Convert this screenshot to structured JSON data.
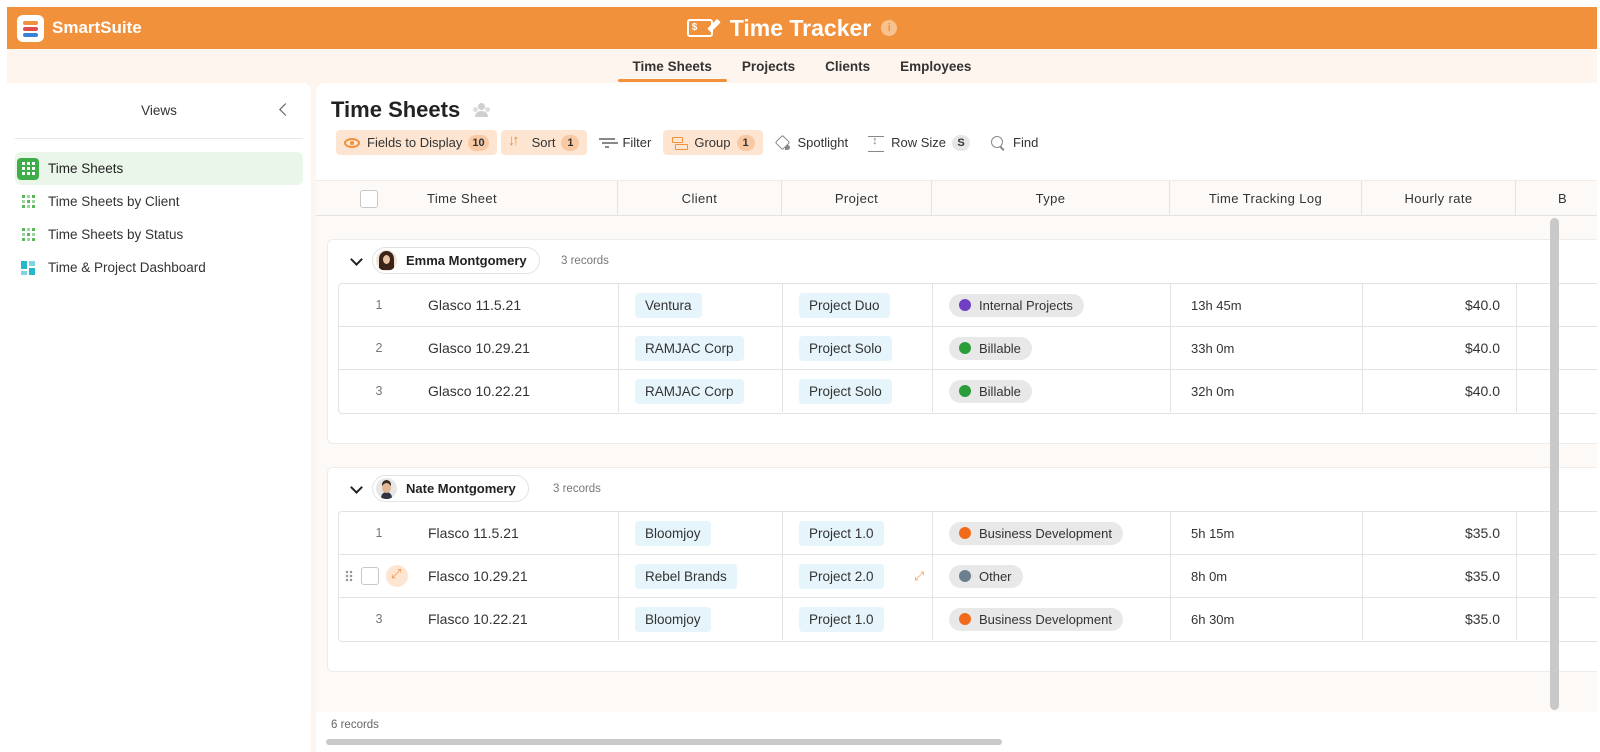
{
  "brand": {
    "name": "SmartSuite"
  },
  "app": {
    "title": "Time Tracker",
    "info": "i"
  },
  "nav": {
    "tabs": [
      "Time Sheets",
      "Projects",
      "Clients",
      "Employees"
    ]
  },
  "sidebar": {
    "title": "Views",
    "items": [
      {
        "label": "Time Sheets"
      },
      {
        "label": "Time Sheets by Client"
      },
      {
        "label": "Time Sheets by Status"
      },
      {
        "label": "Time & Project Dashboard"
      }
    ]
  },
  "main": {
    "title": "Time Sheets",
    "toolbar": {
      "fields_label": "Fields to Display",
      "fields_count": "10",
      "sort_label": "Sort",
      "sort_count": "1",
      "filter_label": "Filter",
      "group_label": "Group",
      "group_count": "1",
      "spotlight_label": "Spotlight",
      "rowsize_label": "Row Size",
      "rowsize_value": "S",
      "find_label": "Find"
    },
    "columns": [
      "Time Sheet",
      "Client",
      "Project",
      "Type",
      "Time Tracking Log",
      "Hourly rate",
      "B"
    ],
    "groups": [
      {
        "assignee": "Emma Montgomery",
        "count": "3 records",
        "rows": [
          {
            "idx": "1",
            "name": "Glasco 11.5.21",
            "client": "Ventura",
            "project": "Project Duo",
            "type": "Internal Projects",
            "type_color": "#6f3fc4",
            "log": "13h 45m",
            "rate": "$40.0"
          },
          {
            "idx": "2",
            "name": "Glasco 10.29.21",
            "client": "RAMJAC Corp",
            "project": "Project Solo",
            "type": "Billable",
            "type_color": "#2a9d3a",
            "log": "33h 0m",
            "rate": "$40.0"
          },
          {
            "idx": "3",
            "name": "Glasco 10.22.21",
            "client": "RAMJAC Corp",
            "project": "Project Solo",
            "type": "Billable",
            "type_color": "#2a9d3a",
            "log": "32h 0m",
            "rate": "$40.0"
          }
        ]
      },
      {
        "assignee": "Nate Montgomery",
        "count": "3 records",
        "rows": [
          {
            "idx": "1",
            "name": "Flasco 11.5.21",
            "client": "Bloomjoy",
            "project": "Project 1.0",
            "type": "Business Development",
            "type_color": "#f26b1d",
            "log": "5h 15m",
            "rate": "$35.0"
          },
          {
            "idx": "",
            "name": "Flasco 10.29.21",
            "client": "Rebel Brands",
            "project": "Project 2.0",
            "type": "Other",
            "type_color": "#6b7f8f",
            "log": "8h 0m",
            "rate": "$35.0"
          },
          {
            "idx": "3",
            "name": "Flasco 10.22.21",
            "client": "Bloomjoy",
            "project": "Project 1.0",
            "type": "Business Development",
            "type_color": "#f26b1d",
            "log": "6h 30m",
            "rate": "$35.0"
          }
        ]
      }
    ],
    "footer": "6 records"
  }
}
